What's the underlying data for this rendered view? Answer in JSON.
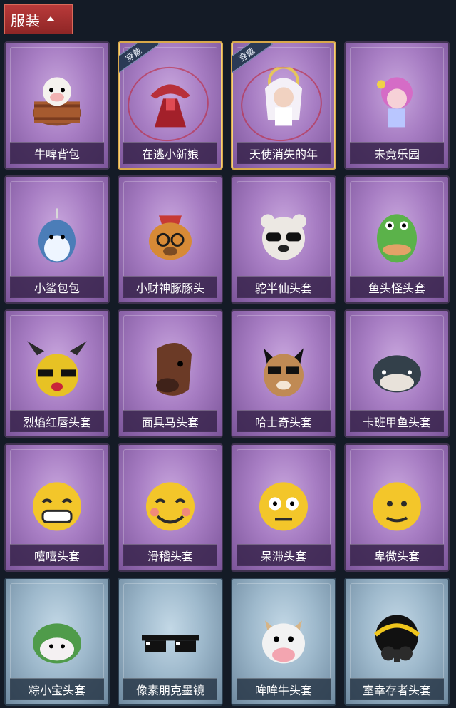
{
  "header": {
    "title": "服装"
  },
  "items": [
    {
      "label": "牛啤背包",
      "tier": "purple",
      "icon": "beer-barrel-cow-icon"
    },
    {
      "label": "在逃小新娘",
      "tier": "purple",
      "icon": "bride-dress-icon",
      "badge": "穿戴"
    },
    {
      "label": "天使消失的年",
      "tier": "purple",
      "icon": "angel-girl-icon",
      "badge": "穿戴"
    },
    {
      "label": "未竟乐园",
      "tier": "purple",
      "icon": "pink-girl-icon"
    },
    {
      "label": "小鲨包包",
      "tier": "purple",
      "icon": "shark-bag-icon"
    },
    {
      "label": "小财神豚豚头",
      "tier": "purple",
      "icon": "capybara-head-icon"
    },
    {
      "label": "驼半仙头套",
      "tier": "purple",
      "icon": "bear-sunglasses-icon"
    },
    {
      "label": "鱼头怪头套",
      "tier": "purple",
      "icon": "fish-head-icon"
    },
    {
      "label": "烈焰红唇头套",
      "tier": "purple",
      "icon": "pikachu-head-icon"
    },
    {
      "label": "面具马头套",
      "tier": "purple",
      "icon": "horse-mask-icon"
    },
    {
      "label": "哈士奇头套",
      "tier": "purple",
      "icon": "husky-head-icon"
    },
    {
      "label": "卡班甲鱼头套",
      "tier": "purple",
      "icon": "fish-blob-icon"
    },
    {
      "label": "嘻嘻头套",
      "tier": "purple",
      "icon": "grinning-emoji-icon"
    },
    {
      "label": "滑稽头套",
      "tier": "purple",
      "icon": "silly-emoji-icon"
    },
    {
      "label": "呆滞头套",
      "tier": "purple",
      "icon": "dazed-emoji-icon"
    },
    {
      "label": "卑微头套",
      "tier": "purple",
      "icon": "humble-emoji-icon"
    },
    {
      "label": "粽小宝头套",
      "tier": "blue",
      "icon": "zongzi-head-icon"
    },
    {
      "label": "像素朋克墨镜",
      "tier": "blue",
      "icon": "pixel-sunglasses-icon"
    },
    {
      "label": "哞哞牛头套",
      "tier": "blue",
      "icon": "cow-head-icon"
    },
    {
      "label": "室幸存者头套",
      "tier": "blue",
      "icon": "gas-mask-icon"
    }
  ]
}
